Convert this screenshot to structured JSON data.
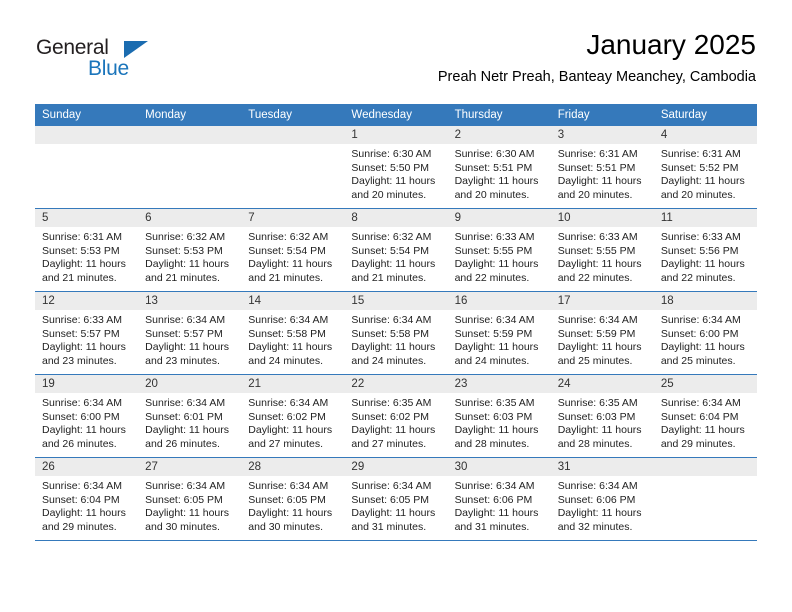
{
  "brand": {
    "name_part1": "General",
    "name_part2": "Blue",
    "accent_color": "#1b75bb"
  },
  "header": {
    "title": "January 2025",
    "subtitle": "Preah Netr Preah, Banteay Meanchey, Cambodia"
  },
  "calendar": {
    "header_bg": "#3579bb",
    "daynum_bg": "#ececec",
    "weekday_headers": [
      "Sunday",
      "Monday",
      "Tuesday",
      "Wednesday",
      "Thursday",
      "Friday",
      "Saturday"
    ],
    "weeks": [
      [
        {
          "day": "",
          "sunrise": "",
          "sunset": "",
          "daylight_line1": "",
          "daylight_line2": ""
        },
        {
          "day": "",
          "sunrise": "",
          "sunset": "",
          "daylight_line1": "",
          "daylight_line2": ""
        },
        {
          "day": "",
          "sunrise": "",
          "sunset": "",
          "daylight_line1": "",
          "daylight_line2": ""
        },
        {
          "day": "1",
          "sunrise": "Sunrise: 6:30 AM",
          "sunset": "Sunset: 5:50 PM",
          "daylight_line1": "Daylight: 11 hours",
          "daylight_line2": "and 20 minutes."
        },
        {
          "day": "2",
          "sunrise": "Sunrise: 6:30 AM",
          "sunset": "Sunset: 5:51 PM",
          "daylight_line1": "Daylight: 11 hours",
          "daylight_line2": "and 20 minutes."
        },
        {
          "day": "3",
          "sunrise": "Sunrise: 6:31 AM",
          "sunset": "Sunset: 5:51 PM",
          "daylight_line1": "Daylight: 11 hours",
          "daylight_line2": "and 20 minutes."
        },
        {
          "day": "4",
          "sunrise": "Sunrise: 6:31 AM",
          "sunset": "Sunset: 5:52 PM",
          "daylight_line1": "Daylight: 11 hours",
          "daylight_line2": "and 20 minutes."
        }
      ],
      [
        {
          "day": "5",
          "sunrise": "Sunrise: 6:31 AM",
          "sunset": "Sunset: 5:53 PM",
          "daylight_line1": "Daylight: 11 hours",
          "daylight_line2": "and 21 minutes."
        },
        {
          "day": "6",
          "sunrise": "Sunrise: 6:32 AM",
          "sunset": "Sunset: 5:53 PM",
          "daylight_line1": "Daylight: 11 hours",
          "daylight_line2": "and 21 minutes."
        },
        {
          "day": "7",
          "sunrise": "Sunrise: 6:32 AM",
          "sunset": "Sunset: 5:54 PM",
          "daylight_line1": "Daylight: 11 hours",
          "daylight_line2": "and 21 minutes."
        },
        {
          "day": "8",
          "sunrise": "Sunrise: 6:32 AM",
          "sunset": "Sunset: 5:54 PM",
          "daylight_line1": "Daylight: 11 hours",
          "daylight_line2": "and 21 minutes."
        },
        {
          "day": "9",
          "sunrise": "Sunrise: 6:33 AM",
          "sunset": "Sunset: 5:55 PM",
          "daylight_line1": "Daylight: 11 hours",
          "daylight_line2": "and 22 minutes."
        },
        {
          "day": "10",
          "sunrise": "Sunrise: 6:33 AM",
          "sunset": "Sunset: 5:55 PM",
          "daylight_line1": "Daylight: 11 hours",
          "daylight_line2": "and 22 minutes."
        },
        {
          "day": "11",
          "sunrise": "Sunrise: 6:33 AM",
          "sunset": "Sunset: 5:56 PM",
          "daylight_line1": "Daylight: 11 hours",
          "daylight_line2": "and 22 minutes."
        }
      ],
      [
        {
          "day": "12",
          "sunrise": "Sunrise: 6:33 AM",
          "sunset": "Sunset: 5:57 PM",
          "daylight_line1": "Daylight: 11 hours",
          "daylight_line2": "and 23 minutes."
        },
        {
          "day": "13",
          "sunrise": "Sunrise: 6:34 AM",
          "sunset": "Sunset: 5:57 PM",
          "daylight_line1": "Daylight: 11 hours",
          "daylight_line2": "and 23 minutes."
        },
        {
          "day": "14",
          "sunrise": "Sunrise: 6:34 AM",
          "sunset": "Sunset: 5:58 PM",
          "daylight_line1": "Daylight: 11 hours",
          "daylight_line2": "and 24 minutes."
        },
        {
          "day": "15",
          "sunrise": "Sunrise: 6:34 AM",
          "sunset": "Sunset: 5:58 PM",
          "daylight_line1": "Daylight: 11 hours",
          "daylight_line2": "and 24 minutes."
        },
        {
          "day": "16",
          "sunrise": "Sunrise: 6:34 AM",
          "sunset": "Sunset: 5:59 PM",
          "daylight_line1": "Daylight: 11 hours",
          "daylight_line2": "and 24 minutes."
        },
        {
          "day": "17",
          "sunrise": "Sunrise: 6:34 AM",
          "sunset": "Sunset: 5:59 PM",
          "daylight_line1": "Daylight: 11 hours",
          "daylight_line2": "and 25 minutes."
        },
        {
          "day": "18",
          "sunrise": "Sunrise: 6:34 AM",
          "sunset": "Sunset: 6:00 PM",
          "daylight_line1": "Daylight: 11 hours",
          "daylight_line2": "and 25 minutes."
        }
      ],
      [
        {
          "day": "19",
          "sunrise": "Sunrise: 6:34 AM",
          "sunset": "Sunset: 6:00 PM",
          "daylight_line1": "Daylight: 11 hours",
          "daylight_line2": "and 26 minutes."
        },
        {
          "day": "20",
          "sunrise": "Sunrise: 6:34 AM",
          "sunset": "Sunset: 6:01 PM",
          "daylight_line1": "Daylight: 11 hours",
          "daylight_line2": "and 26 minutes."
        },
        {
          "day": "21",
          "sunrise": "Sunrise: 6:34 AM",
          "sunset": "Sunset: 6:02 PM",
          "daylight_line1": "Daylight: 11 hours",
          "daylight_line2": "and 27 minutes."
        },
        {
          "day": "22",
          "sunrise": "Sunrise: 6:35 AM",
          "sunset": "Sunset: 6:02 PM",
          "daylight_line1": "Daylight: 11 hours",
          "daylight_line2": "and 27 minutes."
        },
        {
          "day": "23",
          "sunrise": "Sunrise: 6:35 AM",
          "sunset": "Sunset: 6:03 PM",
          "daylight_line1": "Daylight: 11 hours",
          "daylight_line2": "and 28 minutes."
        },
        {
          "day": "24",
          "sunrise": "Sunrise: 6:35 AM",
          "sunset": "Sunset: 6:03 PM",
          "daylight_line1": "Daylight: 11 hours",
          "daylight_line2": "and 28 minutes."
        },
        {
          "day": "25",
          "sunrise": "Sunrise: 6:34 AM",
          "sunset": "Sunset: 6:04 PM",
          "daylight_line1": "Daylight: 11 hours",
          "daylight_line2": "and 29 minutes."
        }
      ],
      [
        {
          "day": "26",
          "sunrise": "Sunrise: 6:34 AM",
          "sunset": "Sunset: 6:04 PM",
          "daylight_line1": "Daylight: 11 hours",
          "daylight_line2": "and 29 minutes."
        },
        {
          "day": "27",
          "sunrise": "Sunrise: 6:34 AM",
          "sunset": "Sunset: 6:05 PM",
          "daylight_line1": "Daylight: 11 hours",
          "daylight_line2": "and 30 minutes."
        },
        {
          "day": "28",
          "sunrise": "Sunrise: 6:34 AM",
          "sunset": "Sunset: 6:05 PM",
          "daylight_line1": "Daylight: 11 hours",
          "daylight_line2": "and 30 minutes."
        },
        {
          "day": "29",
          "sunrise": "Sunrise: 6:34 AM",
          "sunset": "Sunset: 6:05 PM",
          "daylight_line1": "Daylight: 11 hours",
          "daylight_line2": "and 31 minutes."
        },
        {
          "day": "30",
          "sunrise": "Sunrise: 6:34 AM",
          "sunset": "Sunset: 6:06 PM",
          "daylight_line1": "Daylight: 11 hours",
          "daylight_line2": "and 31 minutes."
        },
        {
          "day": "31",
          "sunrise": "Sunrise: 6:34 AM",
          "sunset": "Sunset: 6:06 PM",
          "daylight_line1": "Daylight: 11 hours",
          "daylight_line2": "and 32 minutes."
        },
        {
          "day": "",
          "sunrise": "",
          "sunset": "",
          "daylight_line1": "",
          "daylight_line2": ""
        }
      ]
    ]
  }
}
